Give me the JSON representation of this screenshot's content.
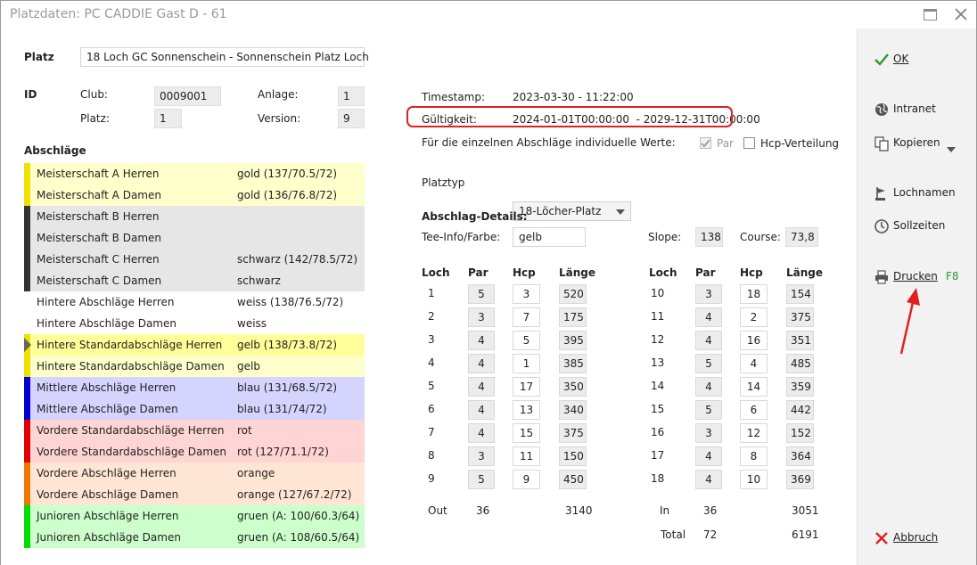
{
  "window": {
    "title": "Platzdaten: PC CADDIE Gast D - 61"
  },
  "platz": {
    "label": "Platz",
    "value": "18 Loch GC Sonnenschein - Sonnenschein Platz Loch"
  },
  "id": {
    "label": "ID",
    "club_label": "Club:",
    "club_value": "0009001",
    "platz_label": "Platz:",
    "platz_value": "1",
    "anlage_label": "Anlage:",
    "anlage_value": "1",
    "version_label": "Version:",
    "version_value": "9"
  },
  "info": {
    "timestamp_label": "Timestamp:",
    "timestamp_value": "2023-03-30 - 11:22:00",
    "gueltigkeit_label": "Gültigkeit:",
    "gueltigkeit_value": "2024-01-01T00:00:00  - 2029-12-31T00:00:00",
    "individual_label": "Für die einzelnen Abschläge individuelle Werte:",
    "par_label": "Par",
    "hcp_verteilung_label": "Hcp-Verteilung",
    "platztyp_label": "Platztyp",
    "platztyp_value": "18-Löcher-Platz"
  },
  "abschlaege": {
    "title": "Abschläge",
    "rows": [
      {
        "name": "Meisterschaft A Herren",
        "value": "gold (137/70.5/72)",
        "bg": "#ffffcc",
        "bar": "#f0e000"
      },
      {
        "name": "Meisterschaft A Damen",
        "value": "gold (136/76.8/72)",
        "bg": "#ffffcc",
        "bar": "#f0e000"
      },
      {
        "name": "Meisterschaft B Herren",
        "value": "",
        "bg": "#e6e6e6",
        "bar": "#333333"
      },
      {
        "name": "Meisterschaft B Damen",
        "value": "",
        "bg": "#e6e6e6",
        "bar": "#333333"
      },
      {
        "name": "Meisterschaft C Herren",
        "value": "schwarz (142/78.5/72)",
        "bg": "#e6e6e6",
        "bar": "#333333"
      },
      {
        "name": "Meisterschaft C Damen",
        "value": "schwarz",
        "bg": "#e6e6e6",
        "bar": "#333333"
      },
      {
        "name": "Hintere Abschläge Herren",
        "value": "weiss (138/76.5/72)",
        "bg": "#ffffff",
        "bar": "#ffffff"
      },
      {
        "name": "Hintere Abschläge Damen",
        "value": "weiss",
        "bg": "#ffffff",
        "bar": "#ffffff"
      },
      {
        "name": "Hintere Standardabschläge Herren",
        "value": "gelb (138/73.8/72)",
        "bg": "#ffff99",
        "bar": "#f0e000",
        "selected": true
      },
      {
        "name": "Hintere Standardabschläge Damen",
        "value": "gelb",
        "bg": "#ffffcc",
        "bar": "#f0e000"
      },
      {
        "name": "Mittlere Abschläge Herren",
        "value": "blau (131/68.5/72)",
        "bg": "#d4d4ff",
        "bar": "#0000cc"
      },
      {
        "name": "Mittlere Abschläge Damen",
        "value": "blau (131/74/72)",
        "bg": "#d4d4ff",
        "bar": "#0000cc"
      },
      {
        "name": "Vordere Standardabschläge Herren",
        "value": "rot",
        "bg": "#ffd4d4",
        "bar": "#e00000"
      },
      {
        "name": "Vordere Standardabschläge Damen",
        "value": "rot (127/71.1/72)",
        "bg": "#ffd4d4",
        "bar": "#e00000"
      },
      {
        "name": "Vordere Abschläge Herren",
        "value": "orange",
        "bg": "#ffe6d4",
        "bar": "#f07800"
      },
      {
        "name": "Vordere Abschläge Damen",
        "value": "orange (127/67.2/72)",
        "bg": "#ffe6d4",
        "bar": "#f07800"
      },
      {
        "name": "Junioren Abschläge Herren",
        "value": "gruen (A: 100/60.3/64)",
        "bg": "#ccffcc",
        "bar": "#00dd00"
      },
      {
        "name": "Junioren Abschläge Damen",
        "value": "gruen (A: 108/60.5/64)",
        "bg": "#ccffcc",
        "bar": "#00dd00"
      }
    ]
  },
  "details": {
    "title": "Abschlag-Details:",
    "tee_label": "Tee-Info/Farbe:",
    "tee_value": "gelb",
    "slope_label": "Slope:",
    "slope_value": "138",
    "course_label": "Course:",
    "course_value": "73,8",
    "col_loch": "Loch",
    "col_par": "Par",
    "col_hcp": "Hcp",
    "col_laenge": "Länge",
    "front": [
      {
        "loch": "1",
        "par": "5",
        "hcp": "3",
        "laenge": "520"
      },
      {
        "loch": "2",
        "par": "3",
        "hcp": "7",
        "laenge": "175"
      },
      {
        "loch": "3",
        "par": "4",
        "hcp": "5",
        "laenge": "395"
      },
      {
        "loch": "4",
        "par": "4",
        "hcp": "1",
        "laenge": "385"
      },
      {
        "loch": "5",
        "par": "4",
        "hcp": "17",
        "laenge": "350"
      },
      {
        "loch": "6",
        "par": "4",
        "hcp": "13",
        "laenge": "340"
      },
      {
        "loch": "7",
        "par": "4",
        "hcp": "15",
        "laenge": "375"
      },
      {
        "loch": "8",
        "par": "3",
        "hcp": "11",
        "laenge": "150"
      },
      {
        "loch": "9",
        "par": "5",
        "hcp": "9",
        "laenge": "450"
      }
    ],
    "back": [
      {
        "loch": "10",
        "par": "3",
        "hcp": "18",
        "laenge": "154"
      },
      {
        "loch": "11",
        "par": "4",
        "hcp": "2",
        "laenge": "375"
      },
      {
        "loch": "12",
        "par": "4",
        "hcp": "16",
        "laenge": "351"
      },
      {
        "loch": "13",
        "par": "5",
        "hcp": "4",
        "laenge": "485"
      },
      {
        "loch": "14",
        "par": "4",
        "hcp": "14",
        "laenge": "359"
      },
      {
        "loch": "15",
        "par": "5",
        "hcp": "6",
        "laenge": "442"
      },
      {
        "loch": "16",
        "par": "3",
        "hcp": "12",
        "laenge": "152"
      },
      {
        "loch": "17",
        "par": "4",
        "hcp": "8",
        "laenge": "364"
      },
      {
        "loch": "18",
        "par": "4",
        "hcp": "10",
        "laenge": "369"
      }
    ],
    "out_label": "Out",
    "out_par": "36",
    "out_laenge": "3140",
    "in_label": "In",
    "in_par": "36",
    "in_laenge": "3051",
    "total_label": "Total",
    "total_par": "72",
    "total_laenge": "6191"
  },
  "sidebar": {
    "ok_label": "OK",
    "intranet_label": "Intranet",
    "kopieren_label": "Kopieren",
    "lochnamen_label": "Lochnamen",
    "sollzeiten_label": "Sollzeiten",
    "drucken_label": "Drucken",
    "drucken_shortcut": "F8",
    "abbruch_label": "Abbruch"
  },
  "colors": {
    "highlight": "#e02020",
    "ok_green": "#2a9a2a",
    "shortcut_green": "#2a9a2a",
    "annotation_arrow": "#e02020"
  }
}
